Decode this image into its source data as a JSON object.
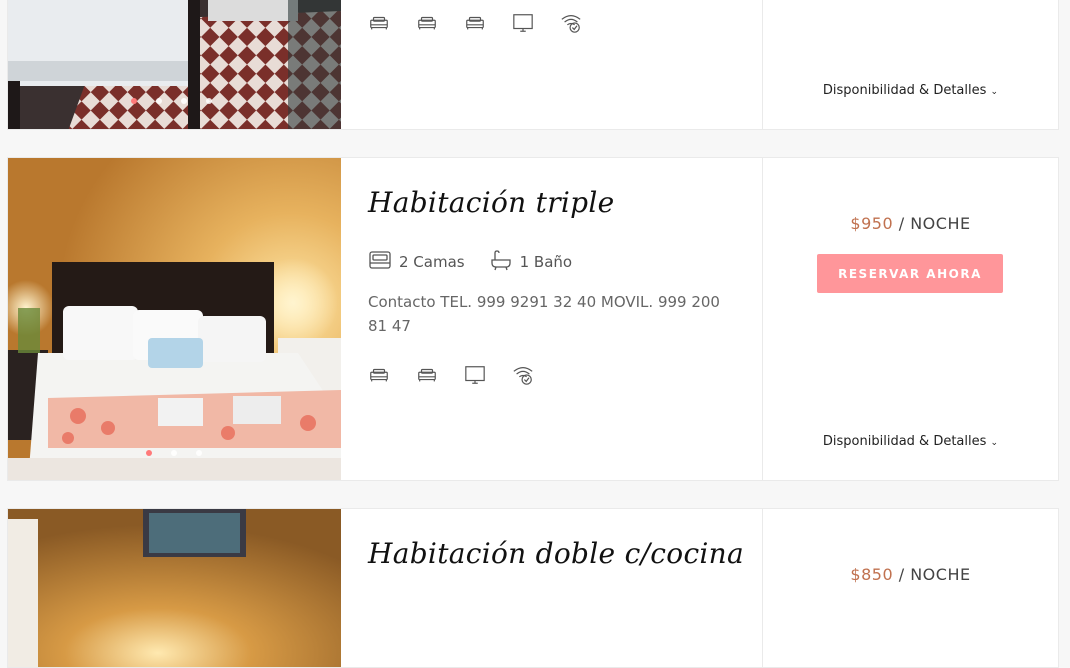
{
  "rooms": [
    {
      "title": "",
      "price": "",
      "per_night": "",
      "details_label": "Disponibilidad & Detalles",
      "amenity_icons": [
        "bed-icon",
        "bed-icon",
        "bed-icon",
        "tv-icon",
        "wifi-icon"
      ]
    },
    {
      "title": "Habitación triple",
      "beds": "2 Camas",
      "baths": "1 Baño",
      "contact": "Contacto TEL. 999 9291 32 40 MOVIL. 999 200 81 47",
      "price": "$950",
      "per_night": " / NOCHE",
      "reserve_label": "RESERVAR AHORA",
      "details_label": "Disponibilidad & Detalles",
      "amenity_icons": [
        "bed-icon",
        "bed-icon",
        "tv-icon",
        "wifi-icon"
      ]
    },
    {
      "title": "Habitación doble c/cocina",
      "price": "$850",
      "per_night": " / NOCHE"
    }
  ],
  "colors": {
    "accent": "#ff969a",
    "price": "#c0714f",
    "active_dot": "#ff7a7a"
  }
}
